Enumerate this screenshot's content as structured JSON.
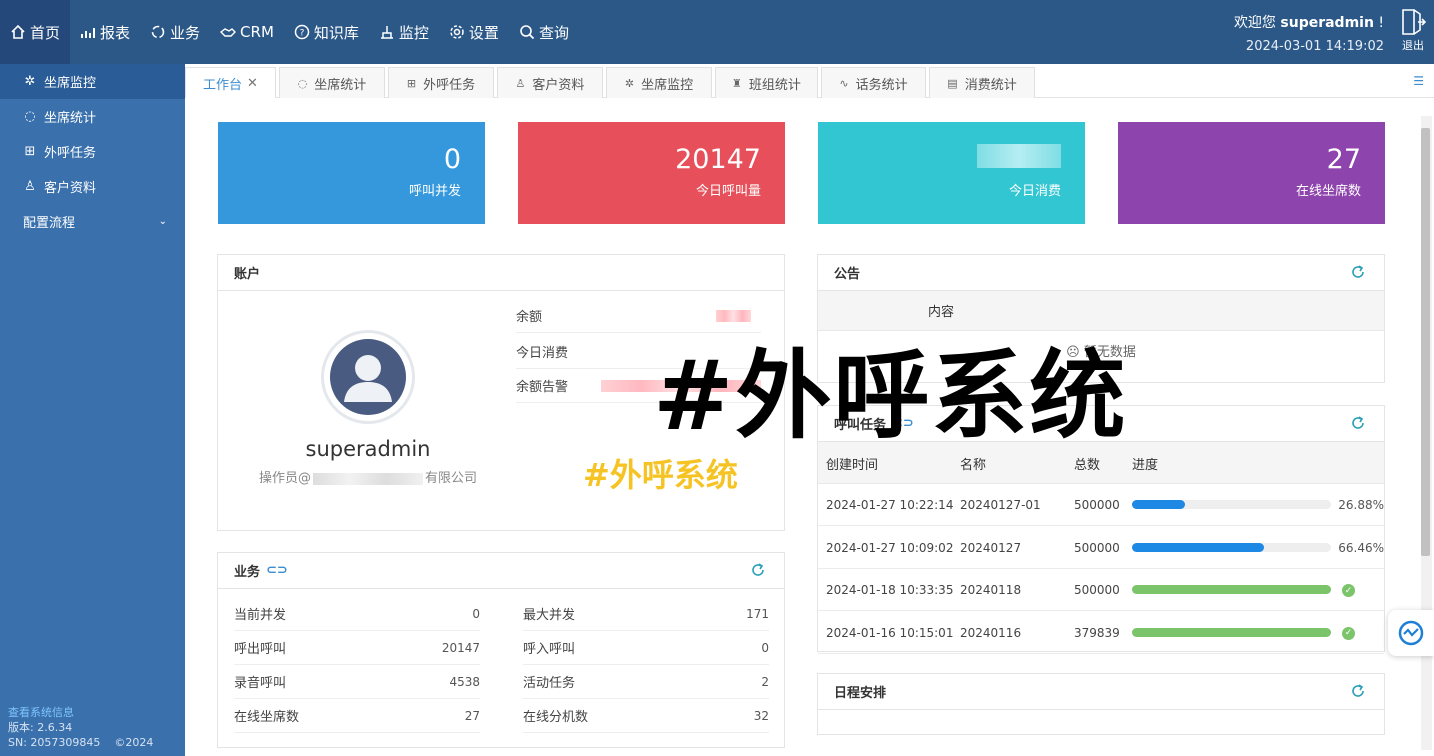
{
  "topnav": [
    {
      "label": "首页",
      "icon": "home-icon"
    },
    {
      "label": "报表",
      "icon": "chart-icon"
    },
    {
      "label": "业务",
      "icon": "refresh-icon"
    },
    {
      "label": "CRM",
      "icon": "handshake-icon"
    },
    {
      "label": "知识库",
      "icon": "question-icon"
    },
    {
      "label": "监控",
      "icon": "monitor-icon"
    },
    {
      "label": "设置",
      "icon": "gear-icon"
    },
    {
      "label": "查询",
      "icon": "search-icon"
    }
  ],
  "header": {
    "welcome_prefix": "欢迎您 ",
    "username": "superadmin",
    "welcome_suffix": " !",
    "datetime": "2024-03-01 14:19:02",
    "logout": "退出"
  },
  "sidebar": {
    "items": [
      {
        "label": "坐席监控"
      },
      {
        "label": "坐席统计"
      },
      {
        "label": "外呼任务"
      },
      {
        "label": "客户资料"
      },
      {
        "label": "配置流程"
      }
    ],
    "footer": {
      "link": "查看系统信息",
      "version": "版本: 2.6.34",
      "sn": "SN: 2057309845",
      "copyright": "©2024"
    }
  },
  "tabs": [
    {
      "label": "工作台"
    },
    {
      "label": "坐席统计"
    },
    {
      "label": "外呼任务"
    },
    {
      "label": "客户资料"
    },
    {
      "label": "坐席监控"
    },
    {
      "label": "班组统计"
    },
    {
      "label": "话务统计"
    },
    {
      "label": "消费统计"
    }
  ],
  "stats": [
    {
      "value": "0",
      "label": "呼叫并发",
      "color": "#3598dc"
    },
    {
      "value": "20147",
      "label": "今日呼叫量",
      "color": "#e7505a"
    },
    {
      "value": "",
      "label": "今日消费",
      "color": "#32c5d2"
    },
    {
      "value": "27",
      "label": "在线坐席数",
      "color": "#8e44ad"
    }
  ],
  "account": {
    "title": "账户",
    "username": "superadmin",
    "org_prefix": "操作员@",
    "org_suffix": "有限公司",
    "rows": [
      {
        "label": "余额"
      },
      {
        "label": "今日消费"
      },
      {
        "label": "余额告警"
      }
    ]
  },
  "notice": {
    "title": "公告",
    "col": "内容",
    "empty": "暂无数据"
  },
  "watermark": {
    "big": "#外呼系统",
    "small": "#外呼系统"
  },
  "business": {
    "title": "业务",
    "left": [
      {
        "label": "当前并发",
        "value": "0"
      },
      {
        "label": "呼出呼叫",
        "value": "20147"
      },
      {
        "label": "录音呼叫",
        "value": "4538"
      },
      {
        "label": "在线坐席数",
        "value": "27"
      }
    ],
    "right": [
      {
        "label": "最大并发",
        "value": "171"
      },
      {
        "label": "呼入呼叫",
        "value": "0"
      },
      {
        "label": "活动任务",
        "value": "2"
      },
      {
        "label": "在线分机数",
        "value": "32"
      }
    ]
  },
  "tasks": {
    "title": "呼叫任务",
    "columns": [
      "创建时间",
      "名称",
      "总数",
      "进度"
    ],
    "rows": [
      {
        "time": "2024-01-27 10:22:14",
        "name": "20240127-01",
        "total": "500000",
        "progress": 0.2688,
        "pct": "26.88%",
        "done": false
      },
      {
        "time": "2024-01-27 10:09:02",
        "name": "20240127",
        "total": "500000",
        "progress": 0.6646,
        "pct": "66.46%",
        "done": false
      },
      {
        "time": "2024-01-18 10:33:35",
        "name": "20240118",
        "total": "500000",
        "progress": 1,
        "pct": "",
        "done": true
      },
      {
        "time": "2024-01-16 10:15:01",
        "name": "20240116",
        "total": "379839",
        "progress": 1,
        "pct": "",
        "done": true
      }
    ]
  },
  "schedule": {
    "title": "日程安排"
  },
  "colors": {
    "topbar": "#2c5888",
    "sidebar": "#3a71ad",
    "accent": "#3b8dd1",
    "bar_blue": "#1e88e5",
    "bar_green": "#7bc46a"
  }
}
